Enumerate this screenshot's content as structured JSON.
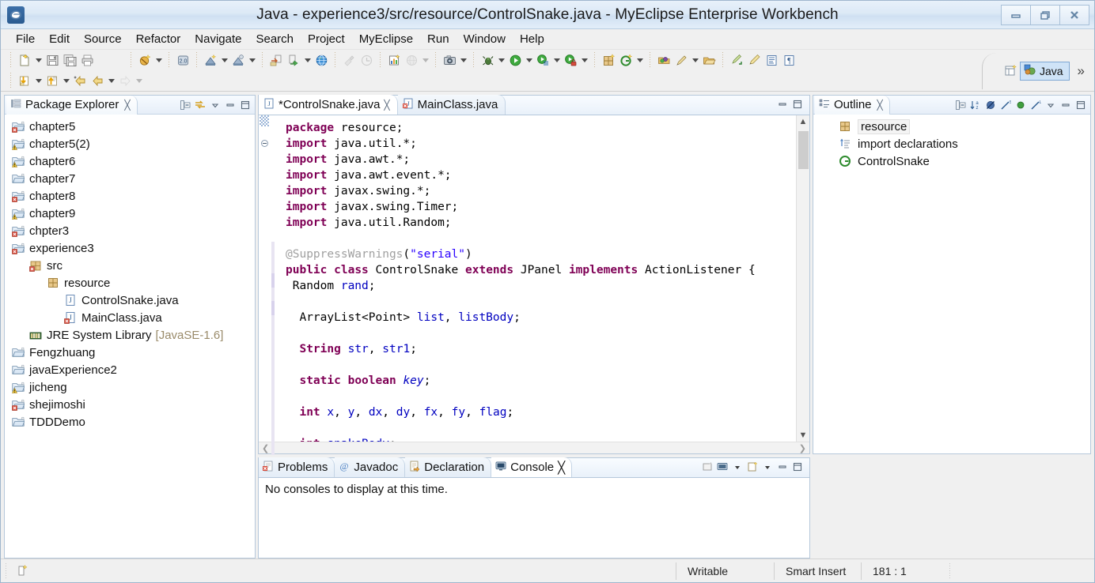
{
  "window": {
    "title": "Java - experience3/src/resource/ControlSnake.java - MyEclipse Enterprise Workbench",
    "app_icon": "eclipse-icon",
    "minimize_label": "minimize-icon",
    "restore_label": "restore-icon",
    "close_label": "close-icon"
  },
  "menu": {
    "items": [
      {
        "label": "File"
      },
      {
        "label": "Edit"
      },
      {
        "label": "Source"
      },
      {
        "label": "Refactor"
      },
      {
        "label": "Navigate"
      },
      {
        "label": "Search"
      },
      {
        "label": "Project"
      },
      {
        "label": "MyEclipse"
      },
      {
        "label": "Run"
      },
      {
        "label": "Window"
      },
      {
        "label": "Help"
      }
    ]
  },
  "toolbar": {
    "overflow_label": "»",
    "perspective": {
      "open_icon": "open-perspective-icon",
      "active_icon": "java-perspective-icon",
      "active_label": "Java"
    },
    "row1": [
      {
        "type": "group",
        "buttons": [
          {
            "name": "new-wizard-icon",
            "icon": "new-file",
            "arrow": true
          },
          {
            "name": "save-icon",
            "icon": "save",
            "arrow": false
          },
          {
            "name": "save-all-icon",
            "icon": "save-all",
            "arrow": false
          },
          {
            "name": "print-icon",
            "icon": "print",
            "arrow": false
          }
        ]
      },
      {
        "type": "group",
        "buttons": [
          {
            "name": "myeclipse-deploy-icon",
            "icon": "deploy",
            "arrow": true
          }
        ]
      },
      {
        "type": "group",
        "buttons": [
          {
            "name": "open-db-browser-icon",
            "icon": "db",
            "arrow": false
          }
        ]
      },
      {
        "type": "group",
        "buttons": [
          {
            "name": "new-web-project-icon",
            "icon": "webproj",
            "arrow": true
          },
          {
            "name": "new-ejb-project-icon",
            "icon": "ejbproj",
            "arrow": true
          }
        ]
      },
      {
        "type": "group",
        "buttons": [
          {
            "name": "import-icon",
            "icon": "import",
            "arrow": false
          },
          {
            "name": "export-server-icon",
            "icon": "exportsrv",
            "arrow": true
          },
          {
            "name": "open-browser-icon",
            "icon": "globe",
            "arrow": false
          }
        ]
      },
      {
        "type": "group",
        "buttons": [
          {
            "name": "build-icon",
            "icon": "build",
            "arrow": false,
            "disabled": true
          },
          {
            "name": "run-last-icon",
            "icon": "runlast",
            "arrow": false,
            "disabled": true
          }
        ]
      },
      {
        "type": "group",
        "buttons": [
          {
            "name": "new-report-icon",
            "icon": "report",
            "arrow": false
          },
          {
            "name": "web-services-icon",
            "icon": "webservice",
            "arrow": true,
            "disabled": true
          }
        ]
      },
      {
        "type": "group",
        "buttons": [
          {
            "name": "snapshot-icon",
            "icon": "camera",
            "arrow": true
          }
        ]
      },
      {
        "type": "group",
        "buttons": [
          {
            "name": "debug-icon",
            "icon": "bug",
            "arrow": true
          },
          {
            "name": "run-icon",
            "icon": "run",
            "arrow": true
          },
          {
            "name": "run-config-icon",
            "icon": "runcfg",
            "arrow": true
          },
          {
            "name": "run-secure-icon",
            "icon": "runsec",
            "arrow": true
          }
        ]
      },
      {
        "type": "group",
        "buttons": [
          {
            "name": "new-java-package-icon",
            "icon": "package",
            "arrow": false
          },
          {
            "name": "new-java-class-icon",
            "icon": "class",
            "arrow": true
          }
        ]
      },
      {
        "type": "group",
        "buttons": [
          {
            "name": "open-type-icon",
            "icon": "opentype",
            "arrow": false
          },
          {
            "name": "search-icon",
            "icon": "pencil",
            "arrow": true
          },
          {
            "name": "open-task-icon",
            "icon": "folder",
            "arrow": false
          }
        ]
      },
      {
        "type": "group",
        "buttons": [
          {
            "name": "next-annotation-icon",
            "icon": "nextanno",
            "arrow": false
          },
          {
            "name": "previous-annotation-icon",
            "icon": "prevanno",
            "arrow": false
          },
          {
            "name": "toggle-block-selection-icon",
            "icon": "blocksel",
            "arrow": false
          },
          {
            "name": "show-whitespace-icon",
            "icon": "pilcrow",
            "arrow": false
          }
        ]
      }
    ],
    "row2": [
      {
        "type": "group",
        "buttons": [
          {
            "name": "step-into-icon",
            "icon": "down-arrow",
            "arrow": true
          },
          {
            "name": "step-return-icon",
            "icon": "up-arrow",
            "arrow": true
          },
          {
            "name": "back-history-icon",
            "icon": "back-star",
            "arrow": false
          },
          {
            "name": "back-icon",
            "icon": "back",
            "arrow": true
          },
          {
            "name": "forward-icon",
            "icon": "forward",
            "arrow": true,
            "disabled": true
          }
        ]
      }
    ]
  },
  "package_explorer": {
    "title": "Package Explorer",
    "close_icon": "close-tab-icon",
    "view_icon": "package-explorer-icon",
    "tools": [
      {
        "name": "collapse-all-icon"
      },
      {
        "name": "link-with-editor-icon"
      },
      {
        "name": "view-menu-icon"
      },
      {
        "name": "minimize-view-icon"
      },
      {
        "name": "maximize-view-icon"
      }
    ],
    "tree": [
      {
        "label": "chapter5",
        "indent": 0,
        "icon": "java-project-error-icon"
      },
      {
        "label": "chapter5(2)",
        "indent": 0,
        "icon": "java-project-warning-icon"
      },
      {
        "label": "chapter6",
        "indent": 0,
        "icon": "java-project-warning-icon"
      },
      {
        "label": "chapter7",
        "indent": 0,
        "icon": "java-project-icon"
      },
      {
        "label": "chapter8",
        "indent": 0,
        "icon": "java-project-error-icon"
      },
      {
        "label": "chapter9",
        "indent": 0,
        "icon": "java-project-warning-icon"
      },
      {
        "label": "chpter3",
        "indent": 0,
        "icon": "java-project-error-icon"
      },
      {
        "label": "experience3",
        "indent": 0,
        "icon": "java-project-error-icon"
      },
      {
        "label": "src",
        "indent": 1,
        "icon": "source-folder-icon"
      },
      {
        "label": "resource",
        "indent": 2,
        "icon": "package-icon"
      },
      {
        "label": "ControlSnake.java",
        "indent": 3,
        "icon": "java-file-icon"
      },
      {
        "label": "MainClass.java",
        "indent": 3,
        "icon": "java-file-error-icon"
      },
      {
        "label": "JRE System Library",
        "suffix": "[JavaSE-1.6]",
        "indent": 1,
        "icon": "library-icon"
      },
      {
        "label": "Fengzhuang",
        "indent": 0,
        "icon": "java-project-icon"
      },
      {
        "label": "javaExperience2",
        "indent": 0,
        "icon": "java-project-icon"
      },
      {
        "label": "jicheng",
        "indent": 0,
        "icon": "java-project-warning-icon"
      },
      {
        "label": "shejimoshi",
        "indent": 0,
        "icon": "java-project-error-icon"
      },
      {
        "label": "TDDDemo",
        "indent": 0,
        "icon": "java-project-icon"
      }
    ]
  },
  "editor": {
    "tabs": [
      {
        "label": "*ControlSnake.java",
        "icon": "java-file-icon",
        "active": true,
        "close_icon": "close-tab-icon"
      },
      {
        "label": "MainClass.java",
        "icon": "java-file-error-icon",
        "active": false
      }
    ],
    "tools": [
      {
        "name": "minimize-editor-icon"
      },
      {
        "name": "maximize-editor-icon"
      }
    ],
    "code_lines": [
      "package resource;",
      "import java.util.*;",
      "import java.awt.*;",
      "import java.awt.event.*;",
      "import javax.swing.*;",
      "import javax.swing.Timer;",
      "import java.util.Random;",
      "",
      "@SuppressWarnings(\"serial\")",
      "public class ControlSnake extends JPanel implements ActionListener {",
      " Random rand;",
      "",
      "  ArrayList<Point> list, listBody;",
      "",
      "  String str, str1;",
      "",
      "  static boolean key;",
      "",
      "  int x, y, dx, dy, fx, fy, flag;",
      "",
      "  int snakeBody;"
    ],
    "scroll_left_icon": "scroll-left-icon",
    "scroll_right_icon": "scroll-right-icon",
    "scroll_up_icon": "scroll-up-icon",
    "scroll_down_icon": "scroll-down-icon"
  },
  "outline": {
    "title": "Outline",
    "close_icon": "close-tab-icon",
    "view_icon": "outline-icon",
    "tools": [
      {
        "name": "collapse-all-icon"
      },
      {
        "name": "sort-icon"
      },
      {
        "name": "hide-fields-icon"
      },
      {
        "name": "hide-static-icon"
      },
      {
        "name": "hide-non-public-icon"
      },
      {
        "name": "hide-local-types-icon"
      },
      {
        "name": "view-menu-icon"
      },
      {
        "name": "minimize-view-icon"
      },
      {
        "name": "maximize-view-icon"
      }
    ],
    "items": [
      {
        "label": "resource",
        "icon": "package-icon",
        "selected": true
      },
      {
        "label": "import declarations",
        "icon": "import-declarations-icon",
        "selected": false
      },
      {
        "label": "ControlSnake",
        "icon": "public-class-icon",
        "selected": false
      }
    ]
  },
  "bottom_panel": {
    "tabs": [
      {
        "label": "Problems",
        "icon": "problems-icon",
        "active": false
      },
      {
        "label": "Javadoc",
        "icon": "javadoc-icon",
        "active": false
      },
      {
        "label": "Declaration",
        "icon": "declaration-icon",
        "active": false
      },
      {
        "label": "Console",
        "icon": "console-icon",
        "active": true,
        "close_icon": "close-tab-icon"
      }
    ],
    "message": "No consoles to display at this time.",
    "tools": [
      {
        "name": "open-console-view-icon"
      },
      {
        "name": "display-selected-console-icon"
      },
      {
        "name": "display-selected-console-arrow-icon"
      },
      {
        "name": "open-console-icon"
      },
      {
        "name": "open-console-arrow-icon"
      },
      {
        "name": "minimize-view-icon"
      },
      {
        "name": "maximize-view-icon"
      }
    ]
  },
  "statusbar": {
    "icon": "writable-mode-icon",
    "cells": [
      {
        "label": "Writable"
      },
      {
        "label": "Smart Insert"
      },
      {
        "label": "181 : 1"
      }
    ]
  },
  "colors": {
    "accent": "#cfe3f7",
    "keyword": "#7f0055",
    "string": "#2a00ff",
    "field": "#0000c0",
    "annotation": "#a0a0a0",
    "title_bar": "#dce9f6"
  }
}
